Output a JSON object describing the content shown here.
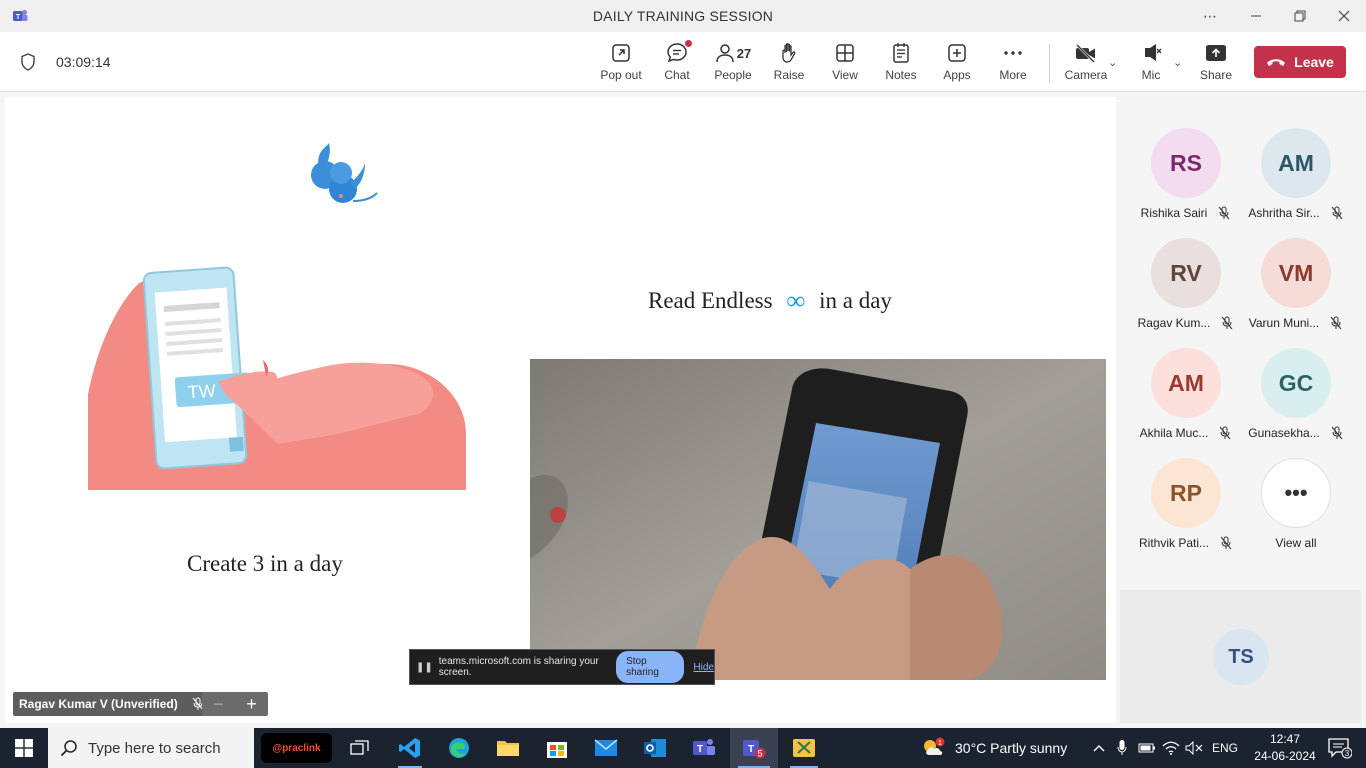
{
  "window": {
    "title": "DAILY TRAINING SESSION"
  },
  "toolbar": {
    "timer": "03:09:14",
    "buttons": [
      {
        "id": "popout",
        "label": "Pop out"
      },
      {
        "id": "chat",
        "label": "Chat"
      },
      {
        "id": "people",
        "label": "People",
        "count": "27"
      },
      {
        "id": "raise",
        "label": "Raise"
      },
      {
        "id": "view",
        "label": "View"
      },
      {
        "id": "notes",
        "label": "Notes"
      },
      {
        "id": "apps",
        "label": "Apps"
      },
      {
        "id": "more",
        "label": "More"
      },
      {
        "id": "camera",
        "label": "Camera"
      },
      {
        "id": "mic",
        "label": "Mic"
      },
      {
        "id": "share",
        "label": "Share"
      }
    ],
    "leave_label": "Leave"
  },
  "stage": {
    "caption_left": "Create 3 in a day",
    "caption_right_prefix": "Read Endless",
    "caption_right_symbol": "∞",
    "caption_right_suffix": "in a day",
    "share_bar": {
      "message": "teams.microsoft.com is sharing your screen.",
      "stop_label": "Stop sharing",
      "hide_label": "Hide"
    },
    "speaker_name": "Ragav Kumar V (Unverified)",
    "zoom_out": "−",
    "zoom_in": "+"
  },
  "participants": [
    {
      "initials": "RS",
      "name": "Rishika Sairi",
      "bg": "#f3dcef",
      "fg": "#7a2a6b"
    },
    {
      "initials": "AM",
      "name": "Ashritha Sir...",
      "bg": "#dce8ee",
      "fg": "#2d5766"
    },
    {
      "initials": "RV",
      "name": "Ragav Kum...",
      "bg": "#e9dfdc",
      "fg": "#5e4540"
    },
    {
      "initials": "VM",
      "name": "Varun Muni...",
      "bg": "#f6dcd7",
      "fg": "#8a3a2e"
    },
    {
      "initials": "AM",
      "name": "Akhila Muc...",
      "bg": "#fde0dc",
      "fg": "#9a3a2c"
    },
    {
      "initials": "GC",
      "name": "Gunasekha...",
      "bg": "#d9eeee",
      "fg": "#2b6464"
    },
    {
      "initials": "RP",
      "name": "Rithvik Pati...",
      "bg": "#fbe6d4",
      "fg": "#8a5424"
    }
  ],
  "view_all_label": "View all",
  "self_initials": "TS",
  "taskbar": {
    "search_placeholder": "Type here to search",
    "praclink_label": "@praclink",
    "teams_badge": "5",
    "weather": "30°C  Partly sunny",
    "weather_badge": "1",
    "language": "ENG",
    "time": "12:47",
    "date": "24-06-2024",
    "notification_count": "3"
  },
  "colors": {
    "leave": "#c4314b",
    "taskbar": "#1c2330",
    "accent": "#1aa0d8"
  }
}
